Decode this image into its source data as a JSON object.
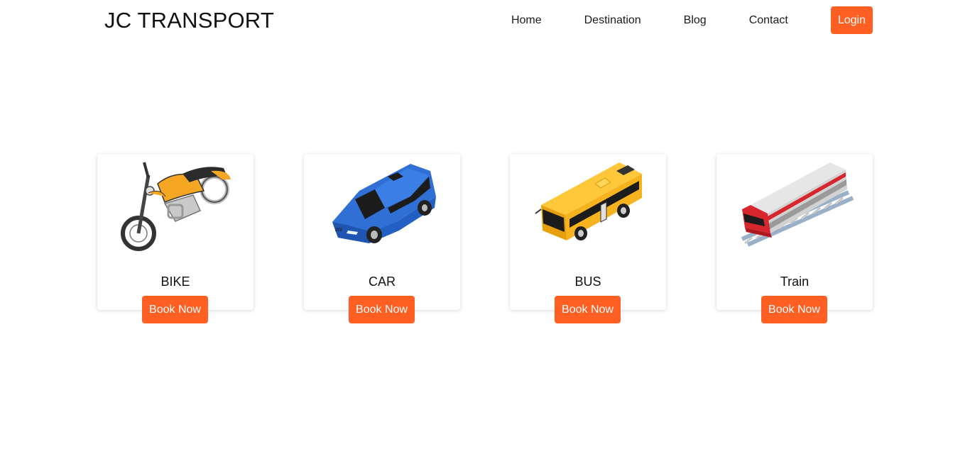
{
  "header": {
    "brand": "JC TRANSPORT",
    "nav": [
      "Home",
      "Destination",
      "Blog",
      "Contact"
    ],
    "login_label": "Login"
  },
  "colors": {
    "accent": "#ff5f22",
    "bike": "#f5a623",
    "car": "#2f6fd6",
    "bus": "#f7b31e",
    "train": "#d8262f"
  },
  "cards": [
    {
      "title": "BIKE",
      "button": "Book Now",
      "icon": "motorcycle-icon"
    },
    {
      "title": "CAR",
      "button": "Book Now",
      "icon": "car-icon"
    },
    {
      "title": "BUS",
      "button": "Book Now",
      "icon": "bus-icon"
    },
    {
      "title": "Train",
      "button": "Book Now",
      "icon": "train-icon"
    }
  ]
}
